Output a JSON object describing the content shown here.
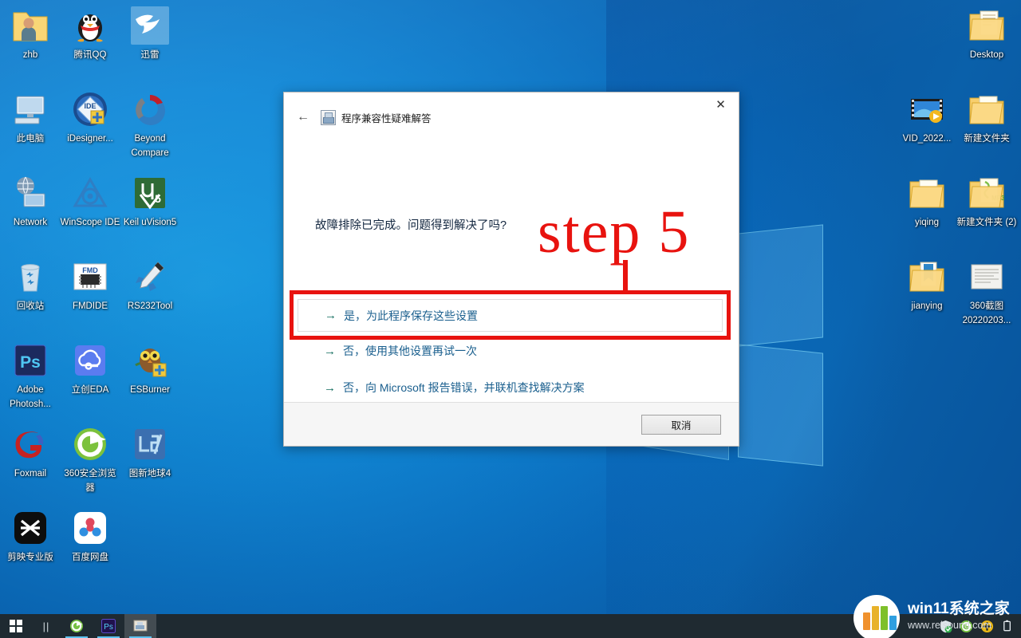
{
  "desktop": {
    "icons_left": [
      {
        "label": "zhb",
        "icon": "folder-user-icon",
        "col": 0,
        "row": 0
      },
      {
        "label": "腾讯QQ",
        "icon": "qq-penguin-icon",
        "col": 1,
        "row": 0
      },
      {
        "label": "迅雷",
        "icon": "thunder-bird-icon",
        "col": 2,
        "row": 0,
        "selected": true
      },
      {
        "label": "此电脑",
        "icon": "this-pc-icon",
        "col": 0,
        "row": 1
      },
      {
        "label": "iDesigner...",
        "icon": "idesigner-icon",
        "col": 1,
        "row": 1
      },
      {
        "label": "Beyond Compare",
        "icon": "beyond-compare-icon",
        "col": 2,
        "row": 1
      },
      {
        "label": "Network",
        "icon": "network-icon",
        "col": 0,
        "row": 2
      },
      {
        "label": "WinScope IDE",
        "icon": "winscope-icon",
        "col": 1,
        "row": 2
      },
      {
        "label": "Keil uVision5",
        "icon": "keil-uvision5-icon",
        "col": 2,
        "row": 2
      },
      {
        "label": "回收站",
        "icon": "recycle-bin-icon",
        "col": 0,
        "row": 3
      },
      {
        "label": "FMDIDE",
        "icon": "fmdide-icon",
        "col": 1,
        "row": 3
      },
      {
        "label": "RS232Tool",
        "icon": "rs232tool-rocket-icon",
        "col": 2,
        "row": 3
      },
      {
        "label": "Adobe Photosh...",
        "icon": "photoshop-icon",
        "col": 0,
        "row": 4
      },
      {
        "label": "立创EDA",
        "icon": "lceda-cloud-icon",
        "col": 1,
        "row": 4
      },
      {
        "label": "ESBurner",
        "icon": "esburner-owl-icon",
        "col": 2,
        "row": 4
      },
      {
        "label": "Foxmail",
        "icon": "foxmail-icon",
        "col": 0,
        "row": 5
      },
      {
        "label": "360安全浏览器",
        "icon": "360-browser-icon",
        "col": 1,
        "row": 5
      },
      {
        "label": "图新地球4",
        "icon": "lsv-earth-icon",
        "col": 2,
        "row": 5
      },
      {
        "label": "剪映专业版",
        "icon": "capcut-icon",
        "col": 0,
        "row": 6
      },
      {
        "label": "百度网盘",
        "icon": "baidu-netdisk-icon",
        "col": 1,
        "row": 6
      }
    ],
    "icons_right": [
      {
        "label": "Desktop",
        "icon": "folder-desktop-icon",
        "col": 1,
        "row": 0
      },
      {
        "label": "VID_2022...",
        "icon": "video-file-icon",
        "col": 0,
        "row": 1
      },
      {
        "label": "新建文件夹",
        "icon": "folder-icon",
        "col": 1,
        "row": 1
      },
      {
        "label": "yiqing",
        "icon": "folder-icon",
        "col": 0,
        "row": 2
      },
      {
        "label": "新建文件夹 (2)",
        "icon": "folder-mp3-icon",
        "col": 1,
        "row": 2
      },
      {
        "label": "jianying",
        "icon": "folder-open-icon",
        "col": 0,
        "row": 3
      },
      {
        "label": "360截图 20220203...",
        "icon": "screenshot-file-icon",
        "col": 1,
        "row": 3
      }
    ]
  },
  "dialog": {
    "title": "程序兼容性疑难解答",
    "back_label": "←",
    "close_label": "✕",
    "question": "故障排除已完成。问题得到解决了吗?",
    "options": [
      {
        "arrow": "→",
        "label": "是，为此程序保存这些设置"
      },
      {
        "arrow": "→",
        "label": "否，使用其他设置再试一次"
      },
      {
        "arrow": "→",
        "label": "否，向 Microsoft 报告错误，并联机查找解决方案"
      }
    ],
    "cancel_label": "取消"
  },
  "annotation": {
    "step_label": "step 5",
    "color": "#e8130f"
  },
  "taskbar": {
    "start_label": "start-button",
    "task_view_label": "task-view",
    "apps": [
      {
        "name": "360-browser",
        "label": "360安全浏览器"
      },
      {
        "name": "photoshop",
        "label": "Ps"
      },
      {
        "name": "troubleshooter",
        "label": "程序兼容性疑难解答",
        "active": true
      }
    ],
    "tray": [
      {
        "name": "security-shield-icon"
      },
      {
        "name": "360-browser-tray-icon"
      },
      {
        "name": "update-plus-icon"
      },
      {
        "name": "usb-device-icon"
      }
    ]
  },
  "watermark": {
    "title": "win11系统之家",
    "url": "www.relsound.com",
    "bar_colors": [
      "#f0912d",
      "#e8b22a",
      "#7ec02a",
      "#2f9fe0"
    ]
  },
  "colors": {
    "desktop_blue": "#1189d8",
    "dialog_bg": "#ffffff",
    "link_blue": "#1a5f8e",
    "arrow_teal": "#0f6b5c",
    "annotation_red": "#e8130f",
    "taskbar": "#1f2a31"
  }
}
